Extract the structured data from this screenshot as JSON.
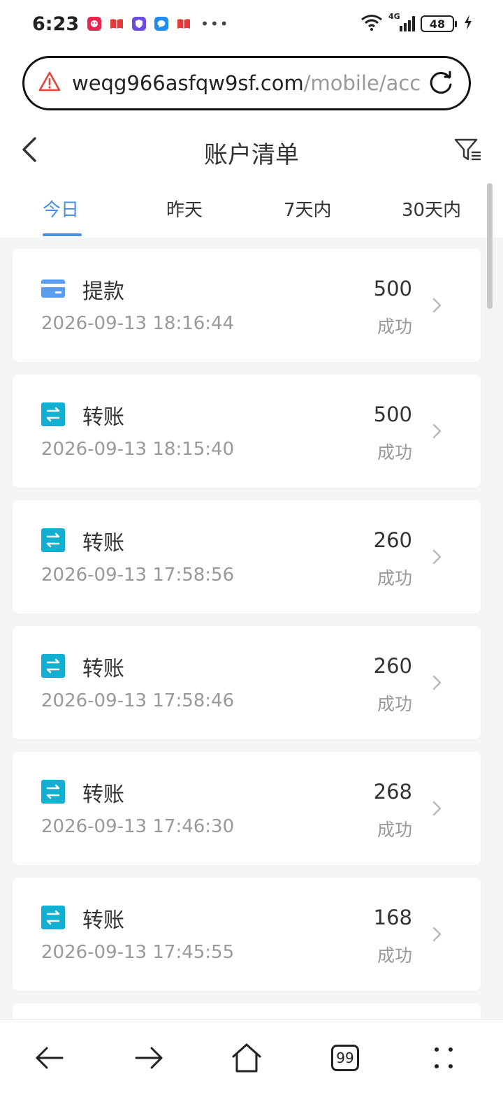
{
  "status_bar": {
    "time": "6:23",
    "network": "4G",
    "battery": "48"
  },
  "browser": {
    "url_domain": "weqg966asfqw9sf.com",
    "url_path": "/mobile/acc",
    "tab_count": "99"
  },
  "header": {
    "title": "账户清单"
  },
  "tabs": [
    {
      "label": "今日",
      "active": true
    },
    {
      "label": "昨天",
      "active": false
    },
    {
      "label": "7天内",
      "active": false
    },
    {
      "label": "30天内",
      "active": false
    }
  ],
  "transactions": [
    {
      "type": "提款",
      "icon": "card-icon",
      "time": "2026-09-13 18:16:44",
      "amount": "500",
      "status": "成功"
    },
    {
      "type": "转账",
      "icon": "transfer-icon",
      "time": "2026-09-13 18:15:40",
      "amount": "500",
      "status": "成功"
    },
    {
      "type": "转账",
      "icon": "transfer-icon",
      "time": "2026-09-13 17:58:56",
      "amount": "260",
      "status": "成功"
    },
    {
      "type": "转账",
      "icon": "transfer-icon",
      "time": "2026-09-13 17:58:46",
      "amount": "260",
      "status": "成功"
    },
    {
      "type": "转账",
      "icon": "transfer-icon",
      "time": "2026-09-13 17:46:30",
      "amount": "268",
      "status": "成功"
    },
    {
      "type": "转账",
      "icon": "transfer-icon",
      "time": "2026-09-13 17:45:55",
      "amount": "168",
      "status": "成功"
    }
  ],
  "colors": {
    "accent": "#4a90e2",
    "withdraw_icon": "#5a9cf0",
    "transfer_icon": "#12b0d0",
    "warning": "#e0463a"
  }
}
